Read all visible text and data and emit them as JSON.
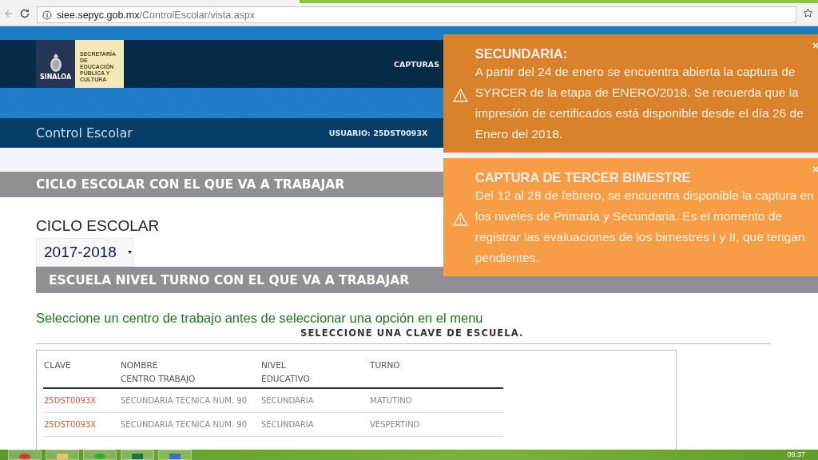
{
  "browser": {
    "url_host": "siee.sepyc.gob.mx",
    "url_path": "/ControlEscolar/vista.aspx"
  },
  "header": {
    "logo_title": "SINALOA",
    "agency": "SECRETARÍA DE EDUCACIÓN PÚBLICA Y CULTURA",
    "nav": [
      "CAPTURAS"
    ],
    "app_title": "Control Escolar",
    "user_label": "USUARIO:",
    "user": "25DST0093X"
  },
  "cycle_section": {
    "title": "CICLO ESCOLAR CON EL QUE VA A TRABAJAR",
    "field_label": "CICLO ESCOLAR",
    "value": "2017-2018"
  },
  "school_section": {
    "title": "ESCUELA NIVEL TURNO CON EL QUE VA A TRABAJAR",
    "hint": "Seleccione un centro de trabajo antes de seleccionar una opción en el menu",
    "table_caption": "SELECCIONE UNA CLAVE DE ESCUELA."
  },
  "table": {
    "columns": [
      "CLAVE",
      "NOMBRE\nCENTRO TRABAJO",
      "NIVEL\nEDUCATIVO",
      "TURNO"
    ],
    "rows": [
      [
        "25DST0093X",
        "SECUNDARIA TECNICA NUM. 90",
        "SECUNDARIA",
        "MATUTINO"
      ],
      [
        "25DST0093X",
        "SECUNDARIA TECNICA NUM. 90",
        "SECUNDARIA",
        "VESPERTINO"
      ]
    ]
  },
  "notices": [
    {
      "title": "SECUNDARIA:",
      "text": "A partir del 24 de enero se encuentra abierta la captura de SYRCER de la etapa de ENERO/2018. Se recuerda que la impresión de certificados está disponible desde el día 26 de Enero del 2018.",
      "color": "#d9822b"
    },
    {
      "title": "CAPTURA DE TERCER BIMESTRE",
      "text": "Del 12 al 28 de febrero, se encuentra disponible la captura en los niveles de Primaria y Secundaria. Es el momento de registrar las evaluaciones de los bimestres I y II, que tengan pendientes.",
      "color": "#f79d45"
    }
  ],
  "taskbar": {
    "clock": "09:37"
  }
}
